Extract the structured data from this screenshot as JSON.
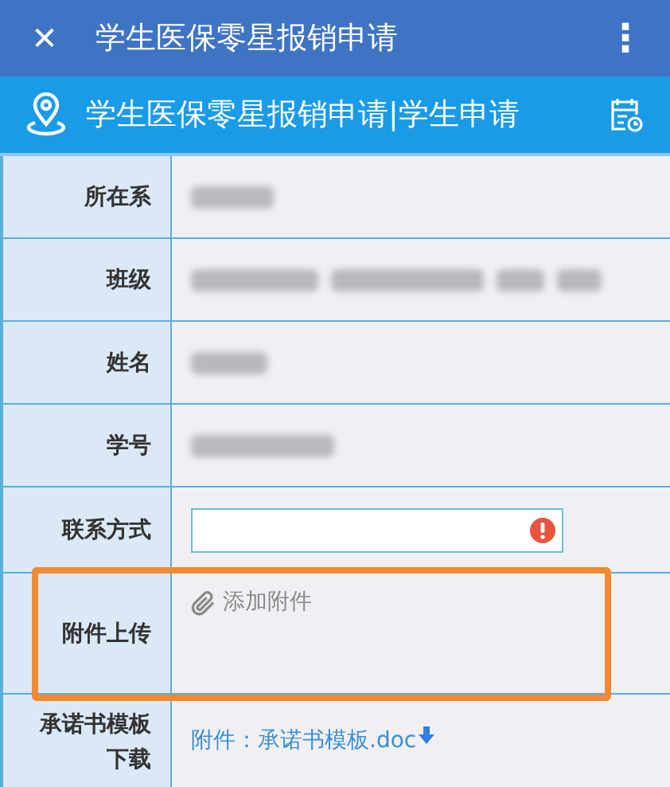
{
  "app_bar": {
    "close": "✕",
    "title": "学生医保零星报销申请",
    "menu": "⋮"
  },
  "breadcrumb": {
    "text": "学生医保零星报销申请|学生申请"
  },
  "form": {
    "rows": [
      {
        "label": "所在系",
        "kind": "redacted"
      },
      {
        "label": "班级",
        "kind": "redacted"
      },
      {
        "label": "姓名",
        "kind": "redacted"
      },
      {
        "label": "学号",
        "kind": "redacted"
      },
      {
        "label": "联系方式",
        "kind": "input",
        "error": true
      },
      {
        "label": "附件上传",
        "kind": "attachment",
        "action": "添加附件",
        "highlighted": true
      },
      {
        "label": "承诺书模板下载",
        "kind": "download",
        "prefix": "附件：",
        "file": "承诺书模板.doc"
      }
    ]
  }
}
